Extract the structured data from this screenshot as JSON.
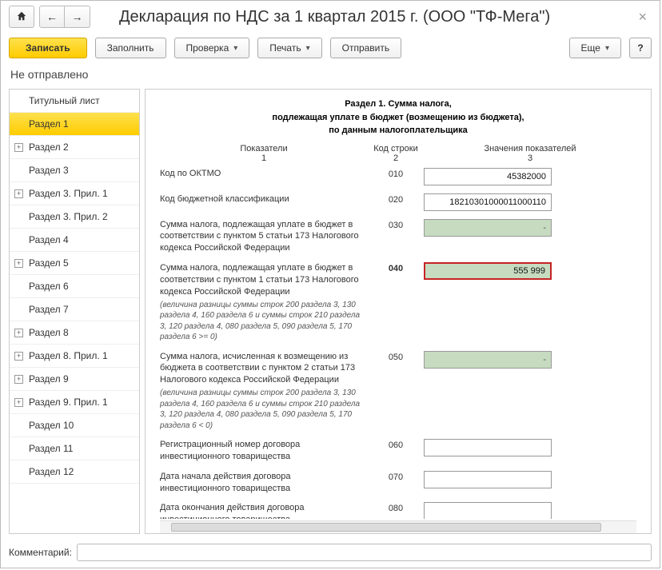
{
  "header": {
    "title": "Декларация по НДС за 1 квартал 2015 г. (ООО \"ТФ-Мега\")"
  },
  "toolbar": {
    "record": "Записать",
    "fill": "Заполнить",
    "check": "Проверка",
    "print": "Печать",
    "send": "Отправить",
    "more": "Еще",
    "help": "?"
  },
  "status": "Не отправлено",
  "sidebar": [
    {
      "label": "Титульный лист",
      "id": "title-page",
      "exp": false
    },
    {
      "label": "Раздел 1",
      "id": "section-1",
      "exp": false,
      "active": true
    },
    {
      "label": "Раздел 2",
      "id": "section-2",
      "exp": true
    },
    {
      "label": "Раздел 3",
      "id": "section-3",
      "exp": false
    },
    {
      "label": "Раздел 3. Прил. 1",
      "id": "section-3-app-1",
      "exp": true
    },
    {
      "label": "Раздел 3. Прил. 2",
      "id": "section-3-app-2",
      "exp": false
    },
    {
      "label": "Раздел 4",
      "id": "section-4",
      "exp": false
    },
    {
      "label": "Раздел 5",
      "id": "section-5",
      "exp": true
    },
    {
      "label": "Раздел 6",
      "id": "section-6",
      "exp": false
    },
    {
      "label": "Раздел 7",
      "id": "section-7",
      "exp": false
    },
    {
      "label": "Раздел 8",
      "id": "section-8",
      "exp": true
    },
    {
      "label": "Раздел 8. Прил. 1",
      "id": "section-8-app-1",
      "exp": true
    },
    {
      "label": "Раздел 9",
      "id": "section-9",
      "exp": true
    },
    {
      "label": "Раздел 9. Прил. 1",
      "id": "section-9-app-1",
      "exp": true
    },
    {
      "label": "Раздел 10",
      "id": "section-10",
      "exp": false
    },
    {
      "label": "Раздел 11",
      "id": "section-11",
      "exp": false
    },
    {
      "label": "Раздел 12",
      "id": "section-12",
      "exp": false
    }
  ],
  "section": {
    "heading_l1": "Раздел 1. Сумма налога,",
    "heading_l2": "подлежащая уплате в бюджет (возмещению из бюджета),",
    "heading_l3": "по данным налогоплательщика",
    "cols": {
      "indicator": "Показатели",
      "indicator_n": "1",
      "code": "Код строки",
      "code_n": "2",
      "values": "Значения показателей",
      "values_n": "3"
    },
    "rows": [
      {
        "code": "010",
        "label": "Код по ОКТМО",
        "value": "45382000",
        "style": "white"
      },
      {
        "code": "020",
        "label": "Код бюджетной классификации",
        "value": "18210301000011000110",
        "style": "white"
      },
      {
        "code": "030",
        "label": "Сумма налога, подлежащая уплате в бюджет в соответствии с пунктом 5 статьи 173 Налогового кодекса Российской Федерации",
        "value": "-",
        "style": "green"
      },
      {
        "code": "040",
        "label": "Сумма налога, подлежащая уплате в бюджет в соответствии с пунктом 1 статьи 173 Налогового кодекса Российской Федерации",
        "sub": "(величина разницы суммы строк 200 раздела 3, 130 раздела 4, 160 раздела 6 и суммы строк 210 раздела 3, 120 раздела 4, 080 раздела 5, 090 раздела 5, 170 раздела 6 >= 0)",
        "value": "555 999",
        "style": "green",
        "hl": true
      },
      {
        "code": "050",
        "label": "Сумма налога, исчисленная к возмещению из бюджета в соответствии с пунктом 2 статьи 173 Налогового кодекса Российской Федерации",
        "sub": "(величина разницы суммы строк 200 раздела 3, 130 раздела 4, 160 раздела 6 и суммы строк 210 раздела 3, 120 раздела 4, 080 раздела 5, 090 раздела 5, 170 раздела 6 < 0)",
        "value": "-",
        "style": "green"
      },
      {
        "code": "060",
        "label": "Регистрационный номер договора инвестиционного товарищества",
        "value": "",
        "style": "white"
      },
      {
        "code": "070",
        "label": "Дата начала действия договора инвестиционного товарищества",
        "value": "",
        "style": "white"
      },
      {
        "code": "080",
        "label": "Дата окончания действия договора инвестиционного товарищества",
        "value": "",
        "style": "white"
      }
    ]
  },
  "footer": {
    "label": "Комментарий:",
    "value": ""
  }
}
